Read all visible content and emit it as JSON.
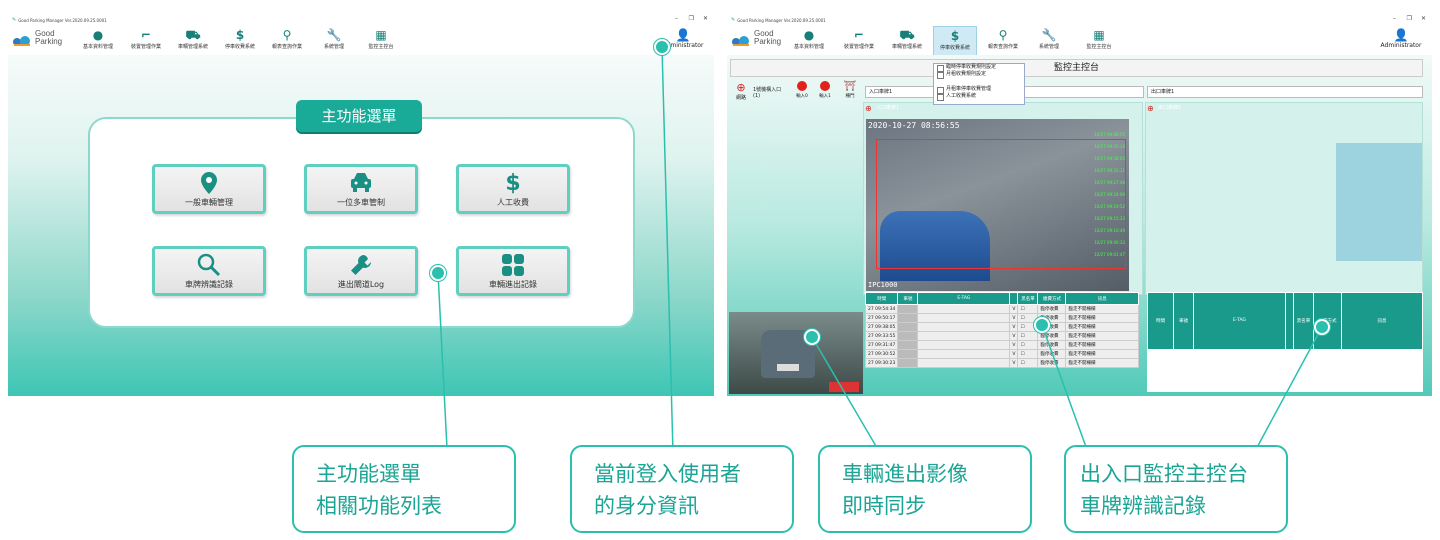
{
  "app": {
    "title": "Good Parking Manager Ver.2020.09.25.0001",
    "logo_line1": "Good",
    "logo_line2": "Parking",
    "admin_label": "Administrator"
  },
  "toolbar": [
    {
      "label": "基本資料管理",
      "icon": "map-pin-icon"
    },
    {
      "label": "裝置管理作業",
      "icon": "device-icon"
    },
    {
      "label": "車輛管理系統",
      "icon": "car-icon"
    },
    {
      "label": "停車收費系統",
      "icon": "dollar-icon"
    },
    {
      "label": "報表查詢作業",
      "icon": "search-icon"
    },
    {
      "label": "系統管理",
      "icon": "wrench-icon"
    },
    {
      "label": "監控主控台",
      "icon": "grid-icon"
    }
  ],
  "main_menu": {
    "title": "主功能選單",
    "buttons": [
      {
        "label": "一般車輛管理",
        "icon": "map-pin-icon",
        "glyph": "📍"
      },
      {
        "label": "一位多車管制",
        "icon": "car-icon",
        "glyph": "🚗"
      },
      {
        "label": "人工收費",
        "icon": "dollar-icon",
        "glyph": "$"
      },
      {
        "label": "車牌辨識記錄",
        "icon": "search-icon",
        "glyph": "🔍"
      },
      {
        "label": "進出閘道Log",
        "icon": "wrench-icon",
        "glyph": "🔧"
      },
      {
        "label": "車輛進出記錄",
        "icon": "grid-icon",
        "glyph": "▦"
      }
    ]
  },
  "dropdown": {
    "items": [
      "臨時停車收費規則設定",
      "月租收費規則設定",
      "月租車停車收費管理",
      "人工收費系統"
    ]
  },
  "monitor": {
    "title": "監控主控台",
    "network_label": "網路",
    "lane_label": "1號機構入口",
    "lane_count": "(1)",
    "in0_label": "輸入0",
    "in1_label": "輸入1",
    "gate_label": "柵門",
    "entry_select": "入口車牌1",
    "exit_select": "出口車牌1",
    "entry_cam_head": "入口車牌1",
    "exit_cam_head": "出口車牌1",
    "timestamp": "2020-10-27 08:56:55",
    "camera_id": "IPC1000",
    "green_entries": [
      "10/27 09:48:55",
      "10/27 09:43:19",
      "10/27 09:38:05",
      "10/27 09:33:11",
      "10/27 09:27:48",
      "10/27 09:24:06",
      "10/27 09:19:52",
      "10/27 09:15:33",
      "10/27 09:10:49",
      "10/27 09:06:32",
      "10/27 09:01:47"
    ]
  },
  "log_table": {
    "headers": [
      "時間",
      "車號",
      "E-TAG",
      "",
      "黑名單",
      "繳費方式",
      "訊息"
    ],
    "rows": [
      {
        "time": "27 09:54:34",
        "v": "V",
        "pay": "臨停收費",
        "msg": "臨走不開柵欄"
      },
      {
        "time": "27 09:50:17",
        "v": "V",
        "pay": "臨停收費",
        "msg": "臨走不開柵欄"
      },
      {
        "time": "27 09:38:05",
        "v": "V",
        "pay": "臨停收費",
        "msg": "臨走不開柵欄"
      },
      {
        "time": "27 09:33:55",
        "v": "V",
        "pay": "臨停收費",
        "msg": "臨走不開柵欄"
      },
      {
        "time": "27 09:31:47",
        "v": "V",
        "pay": "臨停收費",
        "msg": "臨走不開柵欄"
      },
      {
        "time": "27 09:30:52",
        "v": "V",
        "pay": "臨停收費",
        "msg": "臨走不開柵欄"
      },
      {
        "time": "27 09:30:23",
        "v": "V",
        "pay": "臨停收費",
        "msg": "臨走不開柵欄"
      }
    ]
  },
  "callouts": [
    {
      "line1": "主功能選單",
      "line2": "相關功能列表"
    },
    {
      "line1": "當前登入使用者",
      "line2": "的身分資訊"
    },
    {
      "line1": "車輛進出影像",
      "line2": "即時同步"
    },
    {
      "line1": "出入口監控主控台",
      "line2": "車牌辨識記錄"
    }
  ],
  "colors": {
    "accent": "#2bbfae",
    "brand": "#1aa594"
  }
}
